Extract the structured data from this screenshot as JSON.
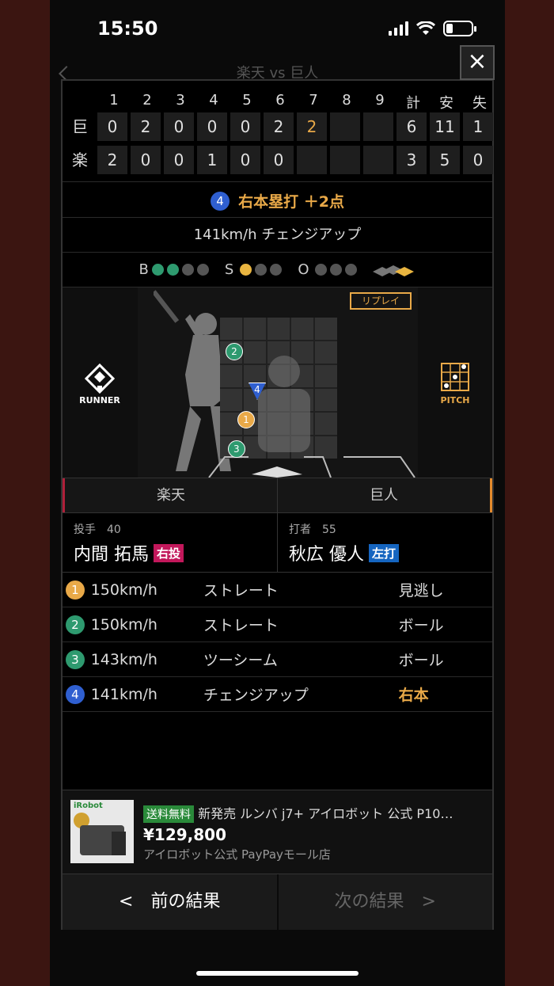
{
  "status": {
    "time": "15:50"
  },
  "background_title": "楽天 vs 巨人",
  "close_label": "×",
  "score": {
    "headers": [
      "1",
      "2",
      "3",
      "4",
      "5",
      "6",
      "7",
      "8",
      "9",
      "計",
      "安",
      "失"
    ],
    "rows": [
      {
        "team": "巨",
        "cells": [
          "0",
          "2",
          "0",
          "0",
          "0",
          "2",
          "2",
          "",
          "",
          "6",
          "11",
          "1"
        ],
        "highlight_index": 6
      },
      {
        "team": "楽",
        "cells": [
          "2",
          "0",
          "0",
          "1",
          "0",
          "0",
          "",
          "",
          "",
          "3",
          "5",
          "0"
        ],
        "highlight_index": -1
      }
    ]
  },
  "play": {
    "badge": "4",
    "text": "右本塁打 ＋2点",
    "pitch": "141km/h チェンジアップ"
  },
  "count": {
    "b_label": "B",
    "s_label": "S",
    "o_label": "O",
    "balls": 2,
    "strikes": 1,
    "outs": 0
  },
  "field": {
    "replay_label": "リプレイ",
    "runner_label": "RUNNER",
    "pitch_label": "PITCH"
  },
  "teams": {
    "left": "楽天",
    "right": "巨人",
    "left_color": "#b0203a",
    "right_color": "#e48a2c"
  },
  "pitcher": {
    "role": "投手　40",
    "name": "内間 拓馬",
    "hand": "右投",
    "hand_color": "#c2185b"
  },
  "batter": {
    "role": "打者　55",
    "name": "秋広 優人",
    "hand": "左打",
    "hand_color": "#1565c0"
  },
  "pitches": [
    {
      "num": "1",
      "color": "#e9a948",
      "speed": "150km/h",
      "type": "ストレート",
      "result": "見逃し",
      "highlight": false
    },
    {
      "num": "2",
      "color": "#2e9a6f",
      "speed": "150km/h",
      "type": "ストレート",
      "result": "ボール",
      "highlight": false
    },
    {
      "num": "3",
      "color": "#2e9a6f",
      "speed": "143km/h",
      "type": "ツーシーム",
      "result": "ボール",
      "highlight": false
    },
    {
      "num": "4",
      "color": "#2f5fd0",
      "speed": "141km/h",
      "type": "チェンジアップ",
      "result": "右本",
      "highlight": true
    }
  ],
  "ad": {
    "tag": "送料無料",
    "title": "新発売 ルンバ j7+ アイロボット 公式 P10…",
    "price": "¥129,800",
    "shop": "アイロボット公式 PayPayモール店",
    "brand": "iRobot"
  },
  "nav": {
    "prev": "<　前の結果",
    "next": "次の結果　>"
  }
}
